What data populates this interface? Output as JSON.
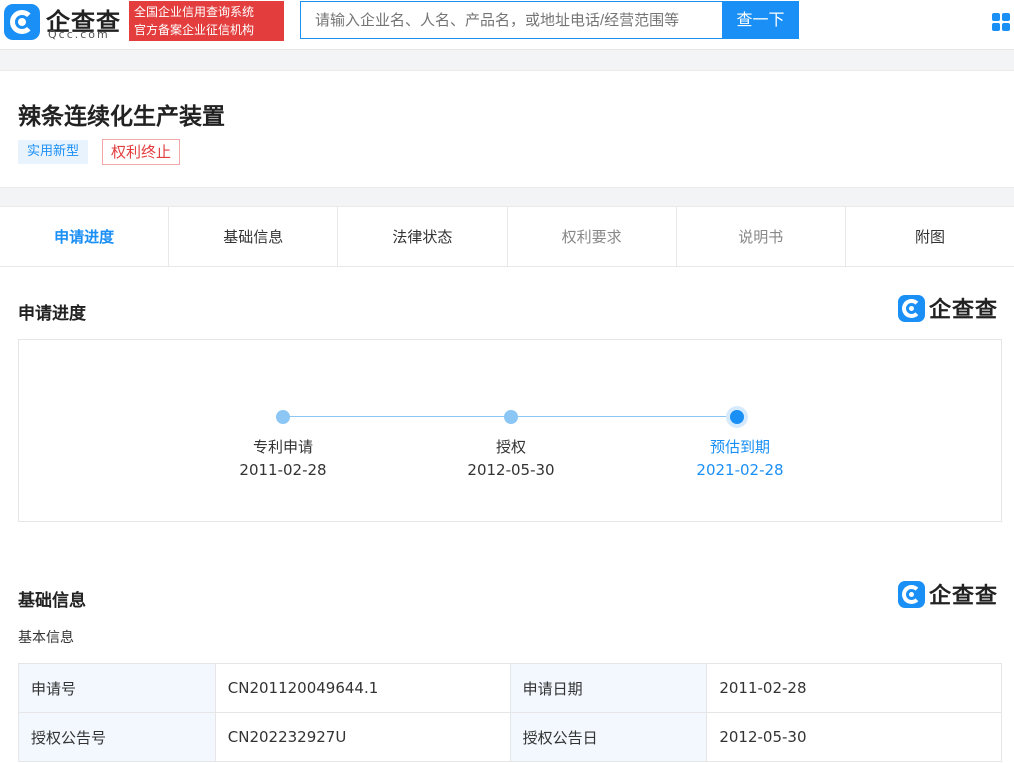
{
  "header": {
    "logo_text": "企查查",
    "logo_sub": "Qcc.com",
    "slogan_line1": "全国企业信用查询系统",
    "slogan_line2": "官方备案企业征信机构",
    "search_placeholder": "请输入企业名、人名、产品名，或地址电话/经营范围等",
    "search_button": "查一下",
    "apps_icon": "grid-apps-icon"
  },
  "patent": {
    "title": "辣条连续化生产装置",
    "type_tag": "实用新型",
    "status_tag": "权利终止"
  },
  "tabs": [
    {
      "label": "申请进度"
    },
    {
      "label": "基础信息"
    },
    {
      "label": "法律状态"
    },
    {
      "label": "权利要求"
    },
    {
      "label": "说明书"
    },
    {
      "label": "附图"
    }
  ],
  "progress": {
    "title": "申请进度",
    "brand_text": "企查查",
    "steps": [
      {
        "name": "专利申请",
        "date": "2011-02-28"
      },
      {
        "name": "授权",
        "date": "2012-05-30"
      },
      {
        "name": "预估到期",
        "date": "2021-02-28"
      }
    ]
  },
  "basic": {
    "title": "基础信息",
    "brand_text": "企查查",
    "subtitle": "基本信息",
    "rows": [
      {
        "label1": "申请号",
        "value1": "CN201120049644.1",
        "label2": "申请日期",
        "value2": "2011-02-28"
      },
      {
        "label1": "授权公告号",
        "value1": "CN202232927U",
        "label2": "授权公告日",
        "value2": "2012-05-30"
      }
    ]
  },
  "colors": {
    "accent": "#1a8ff5",
    "danger": "#e33d3d"
  }
}
